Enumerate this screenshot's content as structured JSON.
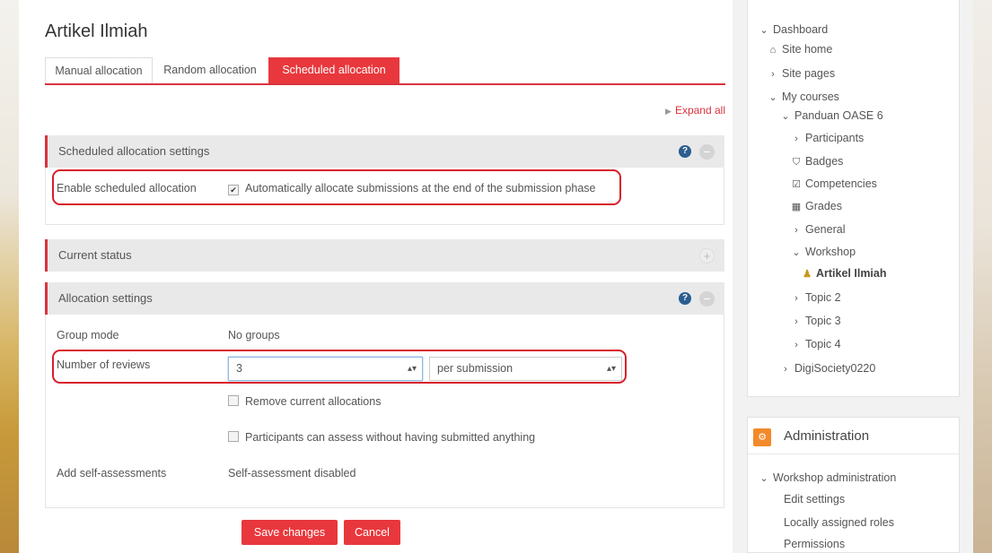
{
  "page": {
    "title": "Artikel Ilmiah",
    "tabs": [
      {
        "label": "Manual allocation"
      },
      {
        "label": "Random allocation"
      },
      {
        "label": "Scheduled allocation"
      }
    ],
    "expand_all": "Expand all"
  },
  "scheduled_settings": {
    "header": "Scheduled allocation settings",
    "enable_label": "Enable scheduled allocation",
    "enable_checkbox_label": "Automatically allocate submissions at the end of the submission phase",
    "enable_checked": true
  },
  "current_status": {
    "header": "Current status"
  },
  "allocation_settings": {
    "header": "Allocation settings",
    "group_mode_label": "Group mode",
    "group_mode_value": "No groups",
    "reviews_label": "Number of reviews",
    "reviews_value": "3",
    "reviews_per": "per submission",
    "remove_current": "Remove current allocations",
    "participants_assess": "Participants can assess without having submitted anything",
    "self_assess_label": "Add self-assessments",
    "self_assess_value": "Self-assessment disabled"
  },
  "actions": {
    "save": "Save changes",
    "cancel": "Cancel"
  },
  "sidebar": {
    "nav": [
      {
        "label": "Dashboard",
        "icon": "chevron-down"
      },
      {
        "label": "Site home",
        "icon": "home"
      },
      {
        "label": "Site pages",
        "icon": "chevron-right"
      },
      {
        "label": "My courses",
        "icon": "chevron-down"
      },
      {
        "label": "Panduan OASE 6",
        "icon": "chevron-down"
      },
      {
        "label": "Participants",
        "icon": "chevron-right"
      },
      {
        "label": "Badges",
        "icon": "shield"
      },
      {
        "label": "Competencies",
        "icon": "check-square"
      },
      {
        "label": "Grades",
        "icon": "table"
      },
      {
        "label": "General",
        "icon": "chevron-right"
      },
      {
        "label": "Workshop",
        "icon": "chevron-down"
      },
      {
        "label": "Artikel Ilmiah",
        "icon": "workshop"
      },
      {
        "label": "Topic 2",
        "icon": "chevron-right"
      },
      {
        "label": "Topic 3",
        "icon": "chevron-right"
      },
      {
        "label": "Topic 4",
        "icon": "chevron-right"
      },
      {
        "label": "DigiSociety0220",
        "icon": "chevron-right"
      }
    ],
    "admin_title": "Administration",
    "admin_items": [
      {
        "label": "Workshop administration",
        "icon": "chevron-down"
      },
      {
        "label": "Edit settings"
      },
      {
        "label": "Locally assigned roles"
      },
      {
        "label": "Permissions"
      }
    ]
  },
  "colors": {
    "accent": "#e8383d",
    "highlight": "#d81e2a",
    "help": "#2a5e8f",
    "admin_icon": "#f28a2b"
  }
}
